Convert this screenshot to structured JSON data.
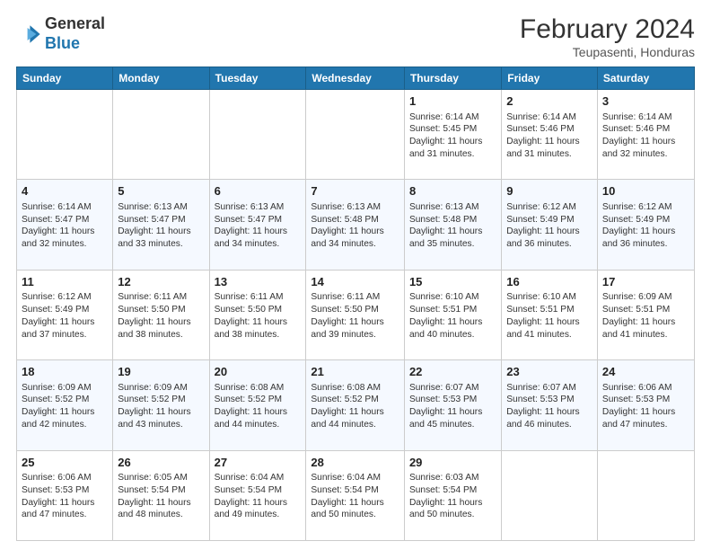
{
  "logo": {
    "general": "General",
    "blue": "Blue"
  },
  "header": {
    "month_year": "February 2024",
    "location": "Teupasenti, Honduras"
  },
  "weekdays": [
    "Sunday",
    "Monday",
    "Tuesday",
    "Wednesday",
    "Thursday",
    "Friday",
    "Saturday"
  ],
  "weeks": [
    [
      {
        "day": "",
        "info": ""
      },
      {
        "day": "",
        "info": ""
      },
      {
        "day": "",
        "info": ""
      },
      {
        "day": "",
        "info": ""
      },
      {
        "day": "1",
        "info": "Sunrise: 6:14 AM\nSunset: 5:45 PM\nDaylight: 11 hours and 31 minutes."
      },
      {
        "day": "2",
        "info": "Sunrise: 6:14 AM\nSunset: 5:46 PM\nDaylight: 11 hours and 31 minutes."
      },
      {
        "day": "3",
        "info": "Sunrise: 6:14 AM\nSunset: 5:46 PM\nDaylight: 11 hours and 32 minutes."
      }
    ],
    [
      {
        "day": "4",
        "info": "Sunrise: 6:14 AM\nSunset: 5:47 PM\nDaylight: 11 hours and 32 minutes."
      },
      {
        "day": "5",
        "info": "Sunrise: 6:13 AM\nSunset: 5:47 PM\nDaylight: 11 hours and 33 minutes."
      },
      {
        "day": "6",
        "info": "Sunrise: 6:13 AM\nSunset: 5:47 PM\nDaylight: 11 hours and 34 minutes."
      },
      {
        "day": "7",
        "info": "Sunrise: 6:13 AM\nSunset: 5:48 PM\nDaylight: 11 hours and 34 minutes."
      },
      {
        "day": "8",
        "info": "Sunrise: 6:13 AM\nSunset: 5:48 PM\nDaylight: 11 hours and 35 minutes."
      },
      {
        "day": "9",
        "info": "Sunrise: 6:12 AM\nSunset: 5:49 PM\nDaylight: 11 hours and 36 minutes."
      },
      {
        "day": "10",
        "info": "Sunrise: 6:12 AM\nSunset: 5:49 PM\nDaylight: 11 hours and 36 minutes."
      }
    ],
    [
      {
        "day": "11",
        "info": "Sunrise: 6:12 AM\nSunset: 5:49 PM\nDaylight: 11 hours and 37 minutes."
      },
      {
        "day": "12",
        "info": "Sunrise: 6:11 AM\nSunset: 5:50 PM\nDaylight: 11 hours and 38 minutes."
      },
      {
        "day": "13",
        "info": "Sunrise: 6:11 AM\nSunset: 5:50 PM\nDaylight: 11 hours and 38 minutes."
      },
      {
        "day": "14",
        "info": "Sunrise: 6:11 AM\nSunset: 5:50 PM\nDaylight: 11 hours and 39 minutes."
      },
      {
        "day": "15",
        "info": "Sunrise: 6:10 AM\nSunset: 5:51 PM\nDaylight: 11 hours and 40 minutes."
      },
      {
        "day": "16",
        "info": "Sunrise: 6:10 AM\nSunset: 5:51 PM\nDaylight: 11 hours and 41 minutes."
      },
      {
        "day": "17",
        "info": "Sunrise: 6:09 AM\nSunset: 5:51 PM\nDaylight: 11 hours and 41 minutes."
      }
    ],
    [
      {
        "day": "18",
        "info": "Sunrise: 6:09 AM\nSunset: 5:52 PM\nDaylight: 11 hours and 42 minutes."
      },
      {
        "day": "19",
        "info": "Sunrise: 6:09 AM\nSunset: 5:52 PM\nDaylight: 11 hours and 43 minutes."
      },
      {
        "day": "20",
        "info": "Sunrise: 6:08 AM\nSunset: 5:52 PM\nDaylight: 11 hours and 44 minutes."
      },
      {
        "day": "21",
        "info": "Sunrise: 6:08 AM\nSunset: 5:52 PM\nDaylight: 11 hours and 44 minutes."
      },
      {
        "day": "22",
        "info": "Sunrise: 6:07 AM\nSunset: 5:53 PM\nDaylight: 11 hours and 45 minutes."
      },
      {
        "day": "23",
        "info": "Sunrise: 6:07 AM\nSunset: 5:53 PM\nDaylight: 11 hours and 46 minutes."
      },
      {
        "day": "24",
        "info": "Sunrise: 6:06 AM\nSunset: 5:53 PM\nDaylight: 11 hours and 47 minutes."
      }
    ],
    [
      {
        "day": "25",
        "info": "Sunrise: 6:06 AM\nSunset: 5:53 PM\nDaylight: 11 hours and 47 minutes."
      },
      {
        "day": "26",
        "info": "Sunrise: 6:05 AM\nSunset: 5:54 PM\nDaylight: 11 hours and 48 minutes."
      },
      {
        "day": "27",
        "info": "Sunrise: 6:04 AM\nSunset: 5:54 PM\nDaylight: 11 hours and 49 minutes."
      },
      {
        "day": "28",
        "info": "Sunrise: 6:04 AM\nSunset: 5:54 PM\nDaylight: 11 hours and 50 minutes."
      },
      {
        "day": "29",
        "info": "Sunrise: 6:03 AM\nSunset: 5:54 PM\nDaylight: 11 hours and 50 minutes."
      },
      {
        "day": "",
        "info": ""
      },
      {
        "day": "",
        "info": ""
      }
    ]
  ]
}
